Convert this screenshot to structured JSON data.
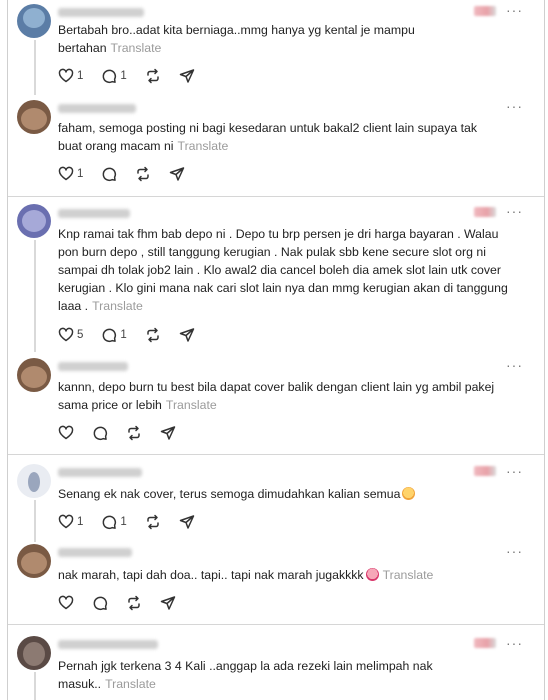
{
  "ui": {
    "translate_label": "Translate",
    "more_label": "···",
    "icons": {
      "like": "heart-icon",
      "reply": "reply-icon",
      "repost": "repost-icon",
      "share": "share-icon",
      "more": "more-icon"
    },
    "colors": {
      "text": "#222222",
      "muted": "#9b9b9b",
      "divider": "#d6d6d6"
    }
  },
  "comments": [
    {
      "text": "Bertabah bro..adat kita berniaga..mmg hanya yg kental je mampu bertahan",
      "likes": "1",
      "replies": "1",
      "emoji": ""
    },
    {
      "text": "faham, semoga posting ni bagi kesedaran untuk bakal2 client lain supaya tak buat orang macam ni",
      "likes": "1",
      "replies": "",
      "emoji": ""
    },
    {
      "text": "Knp ramai tak fhm bab depo ni . Depo tu brp persen je dri harga bayaran . Walau pon burn depo , still tanggung kerugian . Nak pulak sbb kene secure slot org ni sampai dh tolak job2 lain . Klo awal2 dia cancel boleh dia amek slot lain utk cover kerugian . Klo gini mana nak cari slot lain nya dan mmg kerugian akan di tanggung laaa .",
      "likes": "5",
      "replies": "1",
      "emoji": ""
    },
    {
      "text": "kannn, depo burn tu best bila dapat cover balik dengan client lain yg ambil pakej sama price or lebih",
      "likes": "",
      "replies": "",
      "emoji": ""
    },
    {
      "text": "Senang ek nak cover, terus semoga dimudahkan kalian semua",
      "likes": "1",
      "replies": "1",
      "emoji": "hugging-face-emoji"
    },
    {
      "text": "nak marah, tapi dah doa.. tapi.. tapi nak marah jugakkkk",
      "likes": "",
      "replies": "",
      "emoji": "face-blowing-kiss-emoji"
    },
    {
      "text": "Pernah jgk terkena 3 4 Kali ..anggap la ada rezeki lain melimpah nak masuk..",
      "likes": "",
      "replies": "",
      "emoji": ""
    }
  ]
}
